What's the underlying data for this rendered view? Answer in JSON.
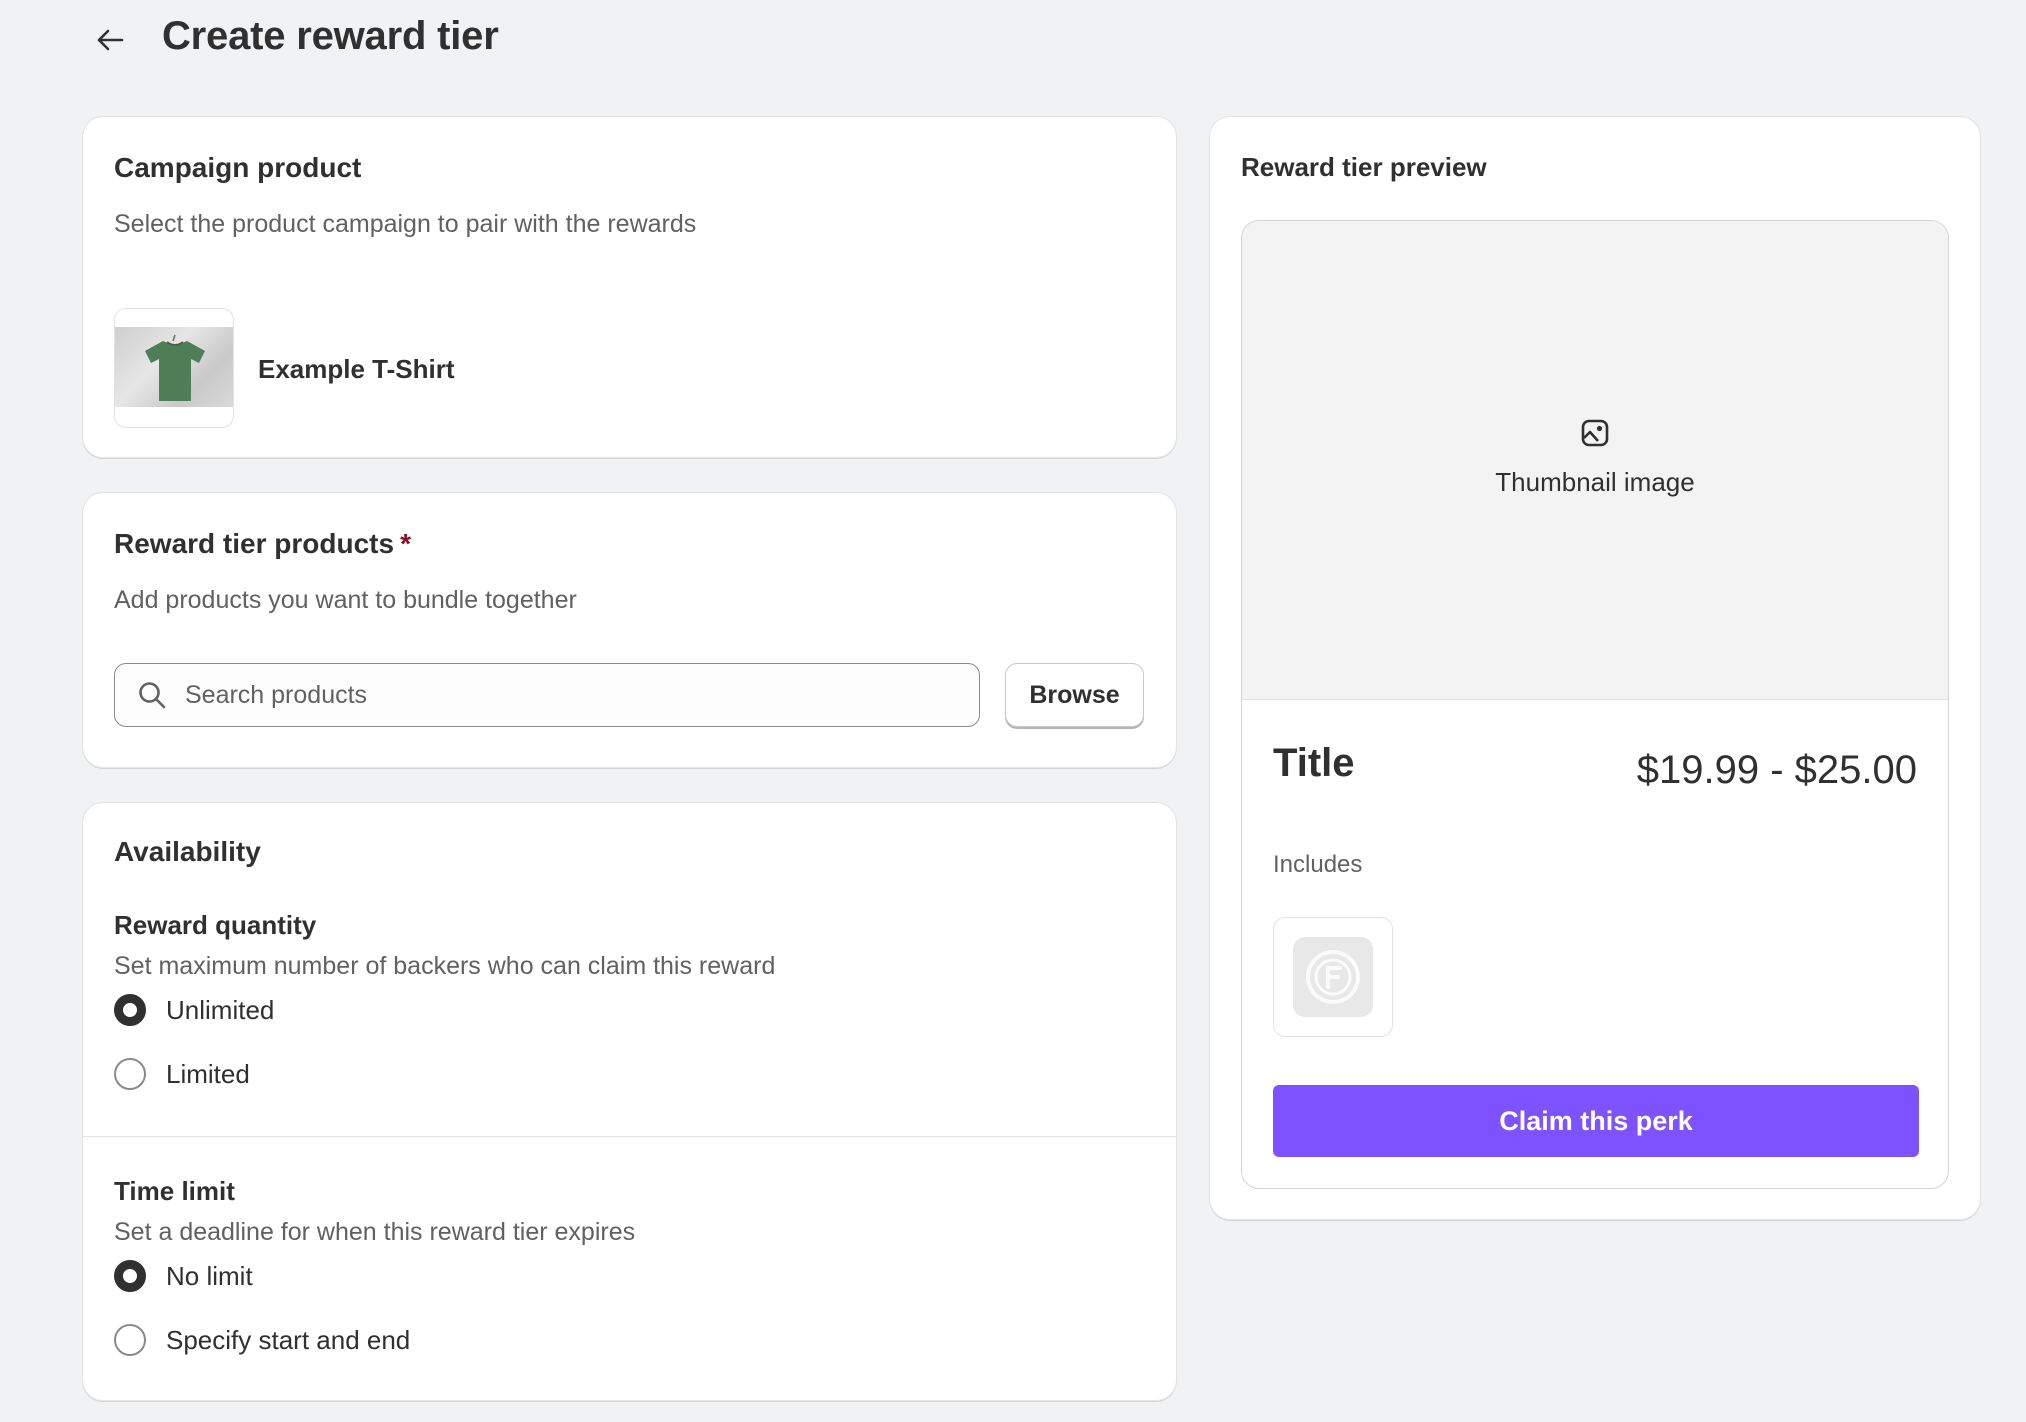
{
  "header": {
    "title": "Create reward tier"
  },
  "campaign": {
    "title": "Campaign product",
    "subtitle": "Select the product campaign to pair with the rewards",
    "product_name": "Example T-Shirt"
  },
  "reward_products": {
    "title": "Reward tier products",
    "required_mark": "*",
    "subtitle": "Add products you want to bundle together",
    "search_placeholder": "Search products",
    "search_value": "",
    "browse_label": "Browse"
  },
  "availability": {
    "title": "Availability",
    "quantity": {
      "title": "Reward quantity",
      "description": "Set maximum number of backers who can claim this reward",
      "options": [
        {
          "label": "Unlimited",
          "selected": true
        },
        {
          "label": "Limited",
          "selected": false
        }
      ]
    },
    "time_limit": {
      "title": "Time limit",
      "description": "Set a deadline for when this reward tier expires",
      "options": [
        {
          "label": "No limit",
          "selected": true
        },
        {
          "label": "Specify start and end",
          "selected": false
        }
      ]
    }
  },
  "preview": {
    "title": "Reward tier preview",
    "thumbnail_label": "Thumbnail image",
    "tier_title": "Title",
    "price": "$19.99 - $25.00",
    "includes_label": "Includes",
    "claim_label": "Claim this perk",
    "accent_color": "#7f52ff"
  },
  "icons": {
    "back": "arrow-left-icon",
    "search": "search-icon",
    "thumbnail": "image-icon",
    "included_item": "placeholder-logo-icon"
  }
}
